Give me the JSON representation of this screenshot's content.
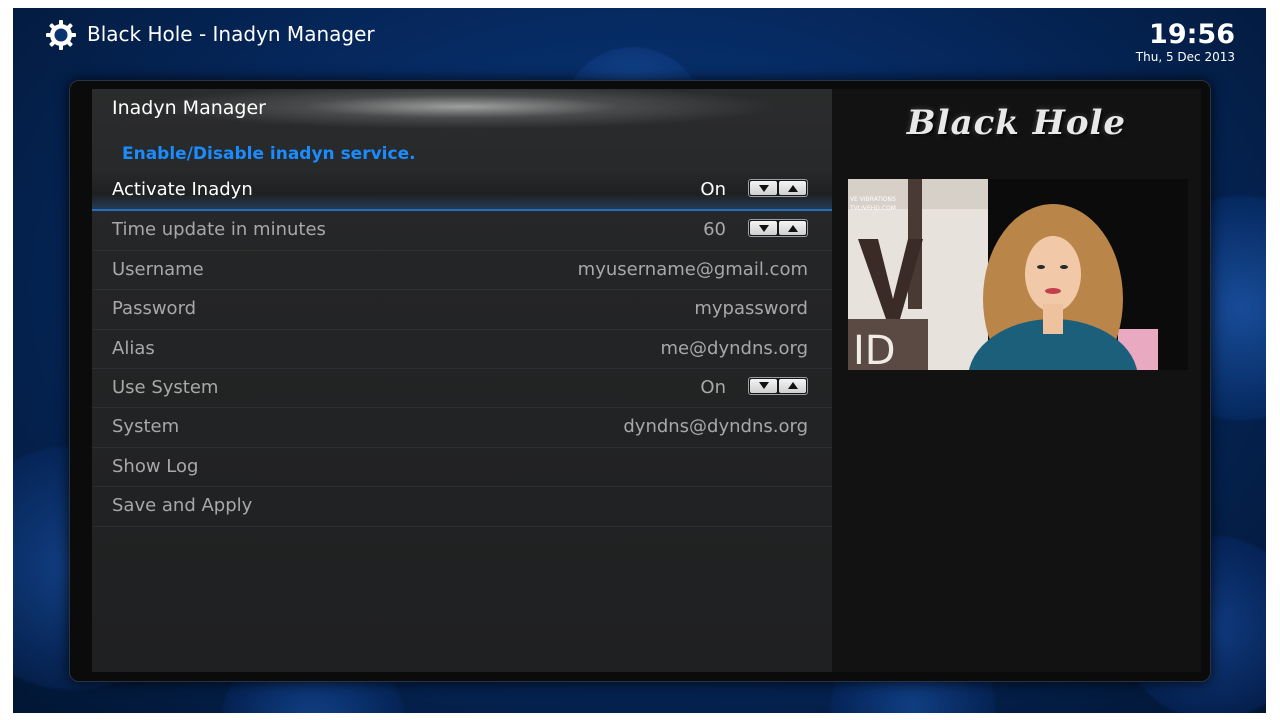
{
  "app": {
    "title": "Black Hole - Inadyn Manager",
    "time": "19:56",
    "date": "Thu, 5 Dec 2013"
  },
  "panel": {
    "title": "Inadyn Manager",
    "description": "Enable/Disable inadyn service.",
    "settings": [
      {
        "label": "Activate Inadyn",
        "value": "On",
        "spinner": true,
        "selected": true
      },
      {
        "label": "Time update in minutes",
        "value": "60",
        "spinner": true,
        "selected": false
      },
      {
        "label": "Username",
        "value": "myusername@gmail.com",
        "spinner": false,
        "selected": false
      },
      {
        "label": "Password",
        "value": "mypassword",
        "spinner": false,
        "selected": false
      },
      {
        "label": "Alias",
        "value": "me@dyndns.org",
        "spinner": false,
        "selected": false
      },
      {
        "label": "Use System",
        "value": "On",
        "spinner": true,
        "selected": false
      },
      {
        "label": "System",
        "value": "dyndns@dyndns.org",
        "spinner": false,
        "selected": false
      },
      {
        "label": "Show Log",
        "value": "",
        "spinner": false,
        "selected": false
      },
      {
        "label": "Save and Apply",
        "value": "",
        "spinner": false,
        "selected": false
      }
    ]
  },
  "sidebar": {
    "logo_text": "Black Hole",
    "preview_caption_lines": [
      "VE VIBRATIONS",
      "TVLIVEHD.COM"
    ]
  },
  "icons": {
    "settings": "gear-icon",
    "spinner_down": "triangle-down-icon",
    "spinner_up": "triangle-up-icon"
  },
  "colors": {
    "accent": "#1a8cff",
    "text_active": "#ffffff",
    "text_inactive": "#a8a8a8",
    "background": "#062a62"
  }
}
